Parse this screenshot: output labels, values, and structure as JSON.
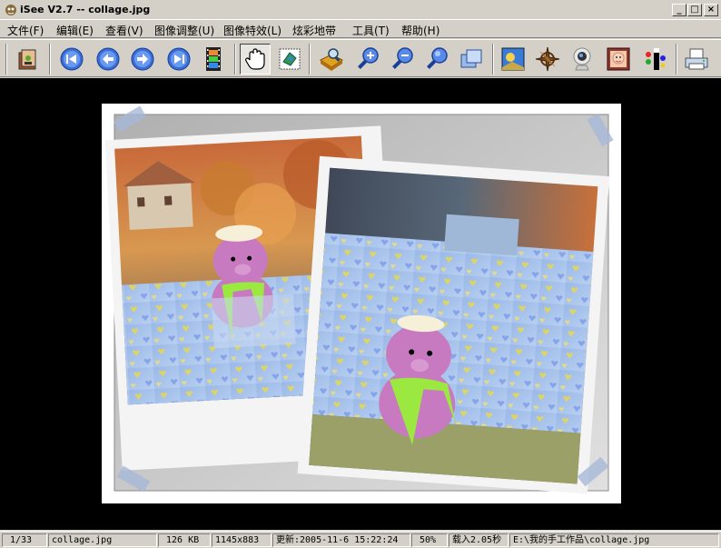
{
  "window": {
    "title": "iSee V2.7 -- collage.jpg",
    "minimize_label": "_",
    "maximize_label": "□",
    "close_label": "×"
  },
  "menu": [
    {
      "label": "文件(F)"
    },
    {
      "label": "编辑(E)"
    },
    {
      "label": "查看(V)"
    },
    {
      "label": "图像调整(U)"
    },
    {
      "label": "图像特效(L)"
    },
    {
      "label": "炫彩地带"
    },
    {
      "label": "工具(T)"
    },
    {
      "label": "帮助(H)"
    }
  ],
  "toolbar": {
    "buttons": [
      {
        "icon": "open-folder-icon"
      },
      {
        "icon": "first-image-icon"
      },
      {
        "icon": "previous-image-icon"
      },
      {
        "icon": "next-image-icon"
      },
      {
        "icon": "last-image-icon"
      },
      {
        "icon": "slideshow-film-icon"
      },
      {
        "icon": "hand-pan-icon",
        "active": true
      },
      {
        "icon": "fit-window-icon"
      },
      {
        "icon": "magnifier-folder-icon"
      },
      {
        "icon": "zoom-in-icon"
      },
      {
        "icon": "zoom-out-icon"
      },
      {
        "icon": "zoom-actual-icon"
      },
      {
        "icon": "full-screen-icon"
      },
      {
        "icon": "wallpaper-icon"
      },
      {
        "icon": "compass-icon"
      },
      {
        "icon": "webcam-icon"
      },
      {
        "icon": "photo-frame-icon"
      },
      {
        "icon": "special-effects-icon"
      },
      {
        "icon": "print-icon"
      }
    ]
  },
  "status": {
    "index": "1/33",
    "filename": "collage.jpg",
    "filesize": "126 KB",
    "dimensions": "1145x883",
    "modified": "更新:2005-11-6 15:22:24",
    "zoom": "50%",
    "load_time": "载入2.05秒",
    "path": "E:\\我的手工作品\\collage.jpg"
  },
  "colors": {
    "chrome": "#d4d0c8",
    "viewer_bg": "#000000",
    "toolbar_blue": "#3a6fd8"
  }
}
